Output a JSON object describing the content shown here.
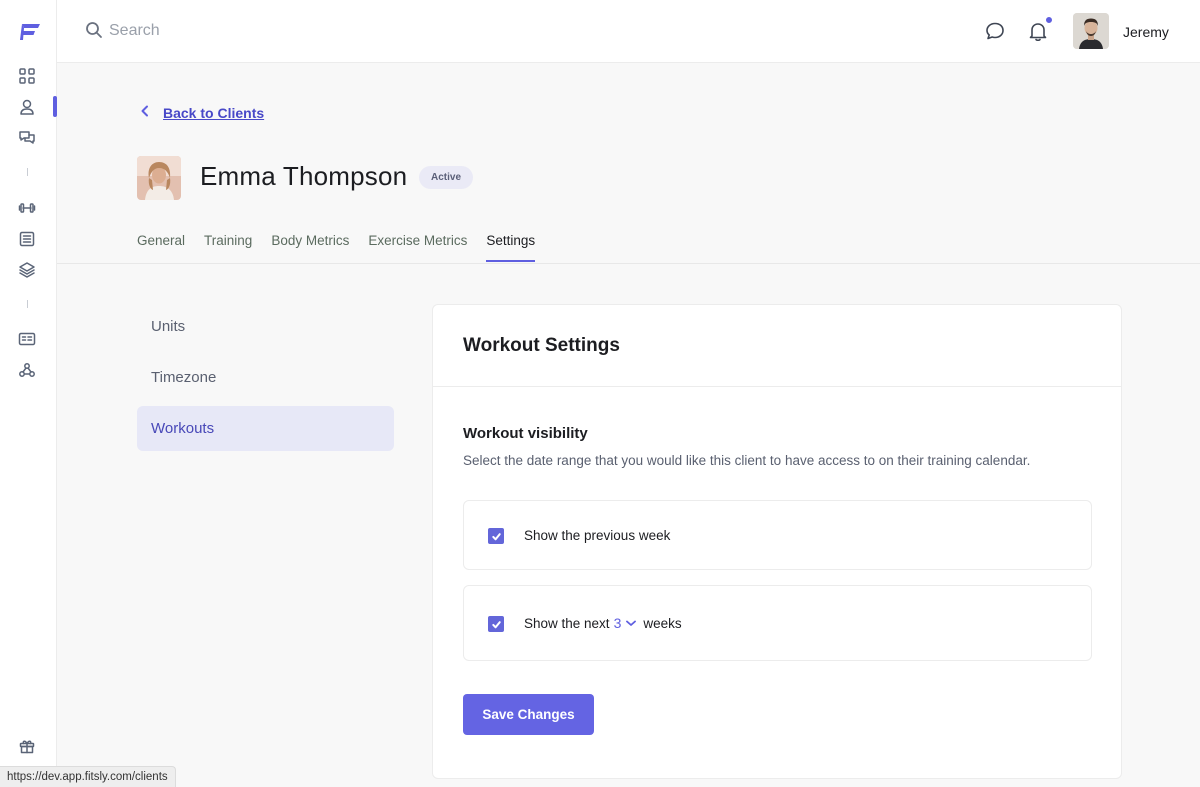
{
  "search": {
    "placeholder": "Search"
  },
  "user": {
    "name": "Jeremy"
  },
  "back_link": {
    "label": "Back to Clients"
  },
  "client": {
    "name": "Emma Thompson",
    "status": "Active"
  },
  "tabs": [
    {
      "label": "General"
    },
    {
      "label": "Training"
    },
    {
      "label": "Body Metrics"
    },
    {
      "label": "Exercise Metrics"
    },
    {
      "label": "Settings"
    }
  ],
  "settings_nav": [
    {
      "label": "Units"
    },
    {
      "label": "Timezone"
    },
    {
      "label": "Workouts"
    }
  ],
  "panel": {
    "title": "Workout Settings",
    "section_title": "Workout visibility",
    "section_desc": "Select the date range that you would like this client to have access to on their training calendar.",
    "option_previous": {
      "label": "Show the previous week",
      "checked": true
    },
    "option_next": {
      "prefix": "Show the next",
      "value": "3",
      "suffix": "weeks",
      "checked": true
    },
    "save_label": "Save Changes"
  },
  "status_bar": {
    "url": "https://dev.app.fitsly.com/clients"
  },
  "colors": {
    "accent": "#5f5fe0",
    "button": "#6464e3",
    "active_nav_bg": "#e7e8f7"
  },
  "icons": [
    "logo-icon",
    "dashboard-icon",
    "user-icon",
    "chat-icon",
    "dumbbell-icon",
    "list-icon",
    "layers-icon",
    "id-card-icon",
    "webhook-icon",
    "gift-icon",
    "search-icon",
    "message-icon",
    "bell-icon"
  ]
}
